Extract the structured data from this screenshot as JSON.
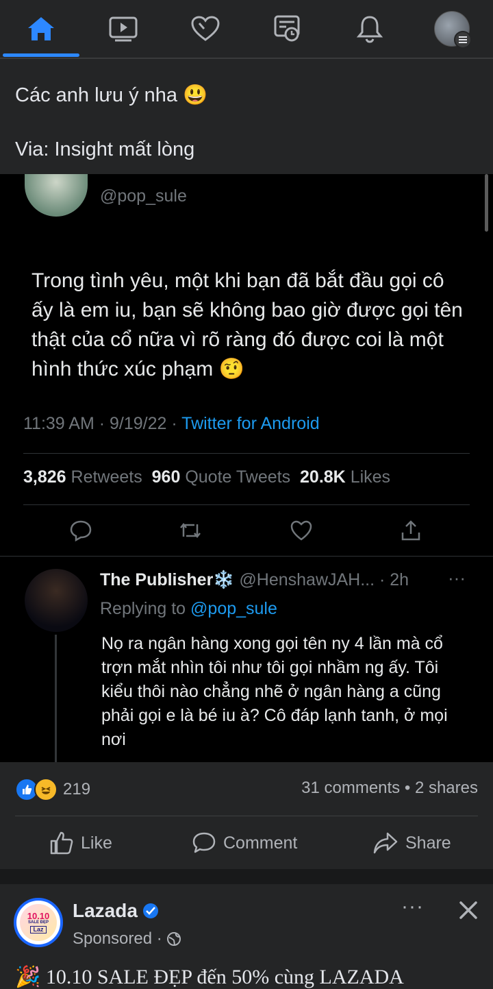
{
  "post": {
    "text_line1": "Các anh lưu ý nha 😃",
    "text_line2": "Via: Insight mất lòng"
  },
  "tweet": {
    "handle": "@pop_sule",
    "text": "Trong tình yêu, một khi bạn đã bắt đầu gọi cô ấy là em iu, bạn sẽ không bao giờ được gọi tên thật của cổ nữa  vì rõ ràng đó được coi là một hình thức xúc phạm 🤨",
    "time": "11:39 AM · 9/19/22 · ",
    "source": "Twitter for Android",
    "retweets_count": "3,826",
    "retweets_label": "Retweets",
    "quotes_count": "960",
    "quotes_label": "Quote Tweets",
    "likes_count": "20.8K",
    "likes_label": "Likes"
  },
  "reply": {
    "name": "The Publisher❄️",
    "handle_time": "@HenshawJAH... · 2h",
    "replying_label": "Replying to ",
    "replying_handle": "@pop_sule",
    "text": "Nọ ra ngân hàng xong gọi tên ny 4 lần mà cổ trợn mắt nhìn tôi như tôi gọi nhầm ng ấy. Tôi kiểu thôi nào chẳng nhẽ ở ngân hàng a cũng phải gọi e là bé iu à? Cô đáp lạnh tanh, ở mọi nơi"
  },
  "reactions": {
    "count": "219",
    "comments": "31 comments",
    "shares": "2 shares",
    "sep": " • "
  },
  "actions": {
    "like": "Like",
    "comment": "Comment",
    "share": "Share"
  },
  "sponsored": {
    "name": "Lazada",
    "label": "Sponsored ·",
    "logo_text": "10.10",
    "logo_sub": "SALE ĐẸP",
    "logo_brand": "Laz",
    "ad_text": "🎉 10.10 SALE ĐẸP đến 50% cùng LAZADA"
  },
  "colors": {
    "accent": "#2d88ff",
    "twitter_blue": "#1d9bf0",
    "background": "#242526"
  }
}
